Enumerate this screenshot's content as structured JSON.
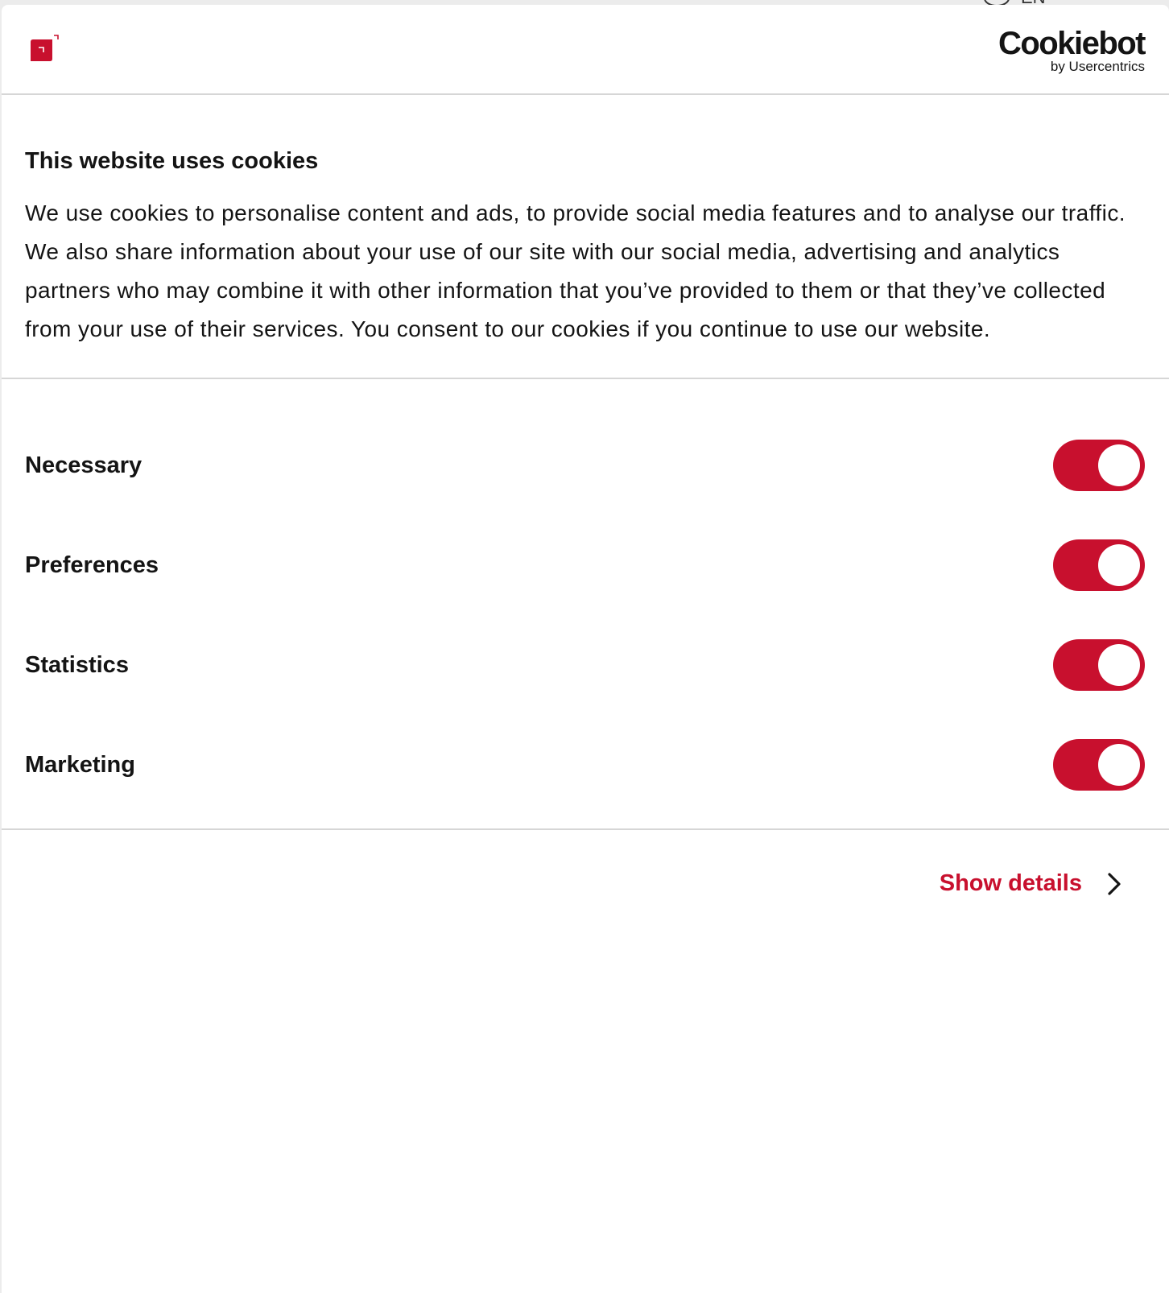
{
  "page_behind": {
    "language_label": "EN"
  },
  "header": {
    "cookiebot_name": "Cookiebot",
    "cookiebot_sub": "by Usercentrics"
  },
  "intro": {
    "title": "This website uses cookies",
    "body": "We use cookies to personalise content and ads, to provide social media features and to analyse our traffic. We also share information about your use of our site with our social media, advertising and analytics partners who may combine it with other information that you’ve provided to them or that they’ve collected from your use of their services. You consent to our cookies if you continue to use our website."
  },
  "categories": [
    {
      "label": "Necessary",
      "enabled": true
    },
    {
      "label": "Preferences",
      "enabled": true
    },
    {
      "label": "Statistics",
      "enabled": true
    },
    {
      "label": "Marketing",
      "enabled": true
    }
  ],
  "footer": {
    "show_details_label": "Show details"
  },
  "colors": {
    "accent": "#c8102e",
    "text": "#141414",
    "divider": "#d6d6d6"
  }
}
